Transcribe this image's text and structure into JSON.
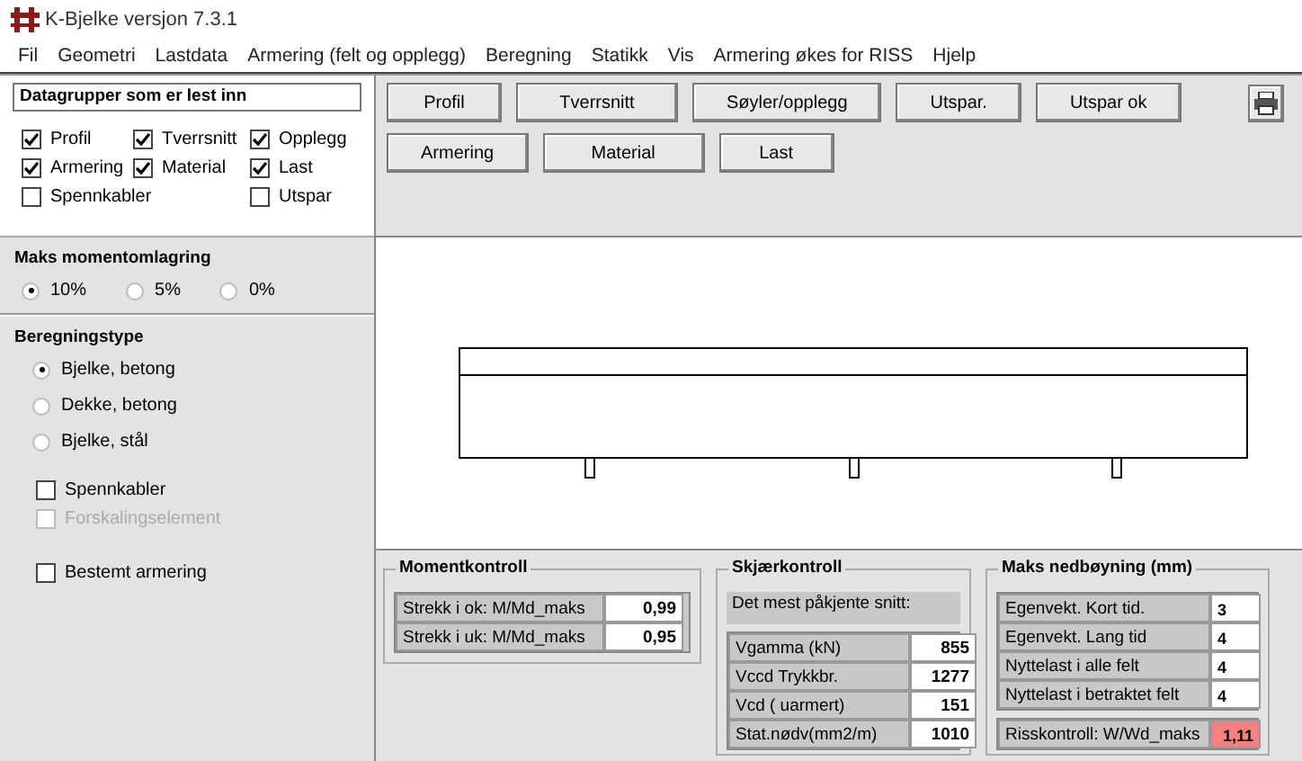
{
  "window": {
    "title": "K-Bjelke  versjon 7.3.1"
  },
  "menu": [
    "Fil",
    "Geometri",
    "Lastdata",
    "Armering (felt og opplegg)",
    "Beregning",
    "Statikk",
    "Vis",
    "Armering økes for RISS",
    "Hjelp"
  ],
  "datagroups": {
    "title": "Datagrupper som er lest inn",
    "rows": [
      [
        {
          "label": "Profil",
          "checked": true
        },
        {
          "label": "Tverrsnitt",
          "checked": true
        },
        {
          "label": "Opplegg",
          "checked": true
        }
      ],
      [
        {
          "label": "Armering",
          "checked": true
        },
        {
          "label": "Material",
          "checked": true
        },
        {
          "label": "Last",
          "checked": true
        }
      ],
      [
        {
          "label": "Spennkabler",
          "checked": false
        },
        "",
        {
          "label": "Utspar",
          "checked": false
        }
      ]
    ]
  },
  "moment_redistribution": {
    "title": "Maks momentomlagring",
    "options": [
      {
        "label": "10%",
        "selected": true
      },
      {
        "label": "5%",
        "selected": false
      },
      {
        "label": "0%",
        "selected": false
      }
    ]
  },
  "calc_type": {
    "title": "Beregningstype",
    "options": [
      {
        "label": "Bjelke, betong",
        "selected": true
      },
      {
        "label": "Dekke, betong",
        "selected": false
      },
      {
        "label": "Bjelke, stål",
        "selected": false
      }
    ],
    "checks": [
      {
        "label": "Spennkabler",
        "checked": false,
        "disabled": false
      },
      {
        "label": "Forskalingselement",
        "checked": false,
        "disabled": true
      },
      {
        "label": "Bestemt armering",
        "checked": false,
        "disabled": false
      }
    ]
  },
  "buttons": [
    [
      "Profil",
      "Tverrsnitt",
      "Søyler/opplegg",
      "Utspar.",
      "Utspar ok"
    ],
    [
      "Armering",
      "Material",
      "Last"
    ]
  ],
  "moment_check": {
    "title": "Momentkontroll",
    "rows": [
      {
        "label": "Strekk i ok: M/Md_maks",
        "value": "0,99"
      },
      {
        "label": "Strekk i uk: M/Md_maks",
        "value": "0,95"
      }
    ]
  },
  "shear_check": {
    "title": "Skjærkontroll",
    "note": "Det mest påkjente snitt:",
    "rows": [
      {
        "label": "Vgamma  (kN)",
        "value": "855"
      },
      {
        "label": "Vccd Trykkbr.",
        "value": "1277"
      },
      {
        "label": "Vcd ( uarmert)",
        "value": "151"
      },
      {
        "label": "Stat.nødv(mm2/m)",
        "value": "1010"
      }
    ]
  },
  "deflection": {
    "title": "Maks nedbøyning  (mm)",
    "rows": [
      {
        "label": "Egenvekt. Kort tid.",
        "value": "3"
      },
      {
        "label": "Egenvekt. Lang tid",
        "value": "4"
      },
      {
        "label": "Nyttelast i alle felt",
        "value": "4"
      },
      {
        "label": "Nyttelast i betraktet felt",
        "value": "4"
      }
    ],
    "crack": {
      "label": "Risskontroll: W/Wd_maks",
      "value": "1,11",
      "warning": true
    }
  }
}
